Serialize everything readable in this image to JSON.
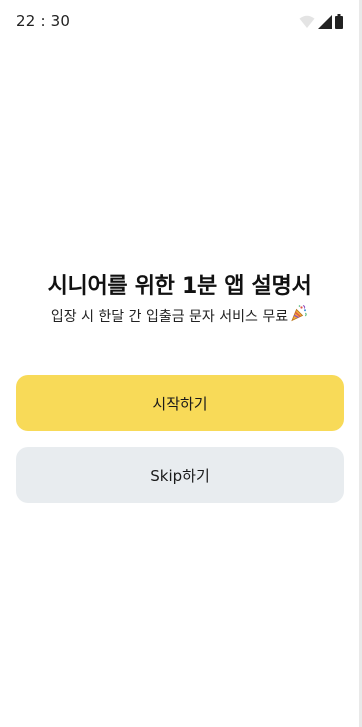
{
  "status_bar": {
    "time": "22 : 30",
    "icons": [
      "wifi-icon",
      "signal-icon",
      "battery-icon"
    ]
  },
  "hero": {
    "title": "시니어를 위한 1분 앱 설명서",
    "subtitle": "입장 시 한달 간 입출금 문자 서비스 무료",
    "subtitle_icon": "party-popper-icon"
  },
  "buttons": {
    "start_label": "시작하기",
    "skip_label": "Skip하기"
  },
  "colors": {
    "primary_button": "#f8da58",
    "secondary_button": "#e8ecef",
    "background": "#ffffff"
  }
}
